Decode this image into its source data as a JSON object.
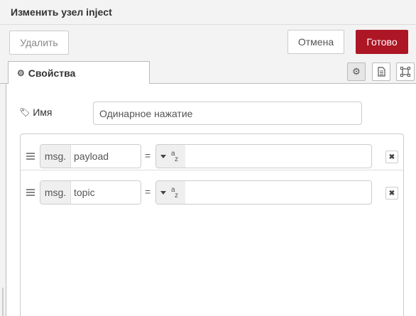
{
  "window": {
    "title": "Изменить узел inject"
  },
  "toolbar": {
    "delete_label": "Удалить",
    "cancel_label": "Отмена",
    "done_label": "Готово"
  },
  "tabs": {
    "properties_label": "Свойства"
  },
  "form": {
    "name_label": "Имя",
    "name_value": "Одинарное нажатие"
  },
  "properties": [
    {
      "prefix": "msg.",
      "field": "payload",
      "equals": "=",
      "type_icon": "string-az-icon",
      "value": ""
    },
    {
      "prefix": "msg.",
      "field": "topic",
      "equals": "=",
      "type_icon": "string-az-icon",
      "value": ""
    }
  ],
  "colors": {
    "primary_button": "#ad1625",
    "header_bg": "#f3f3f3"
  }
}
